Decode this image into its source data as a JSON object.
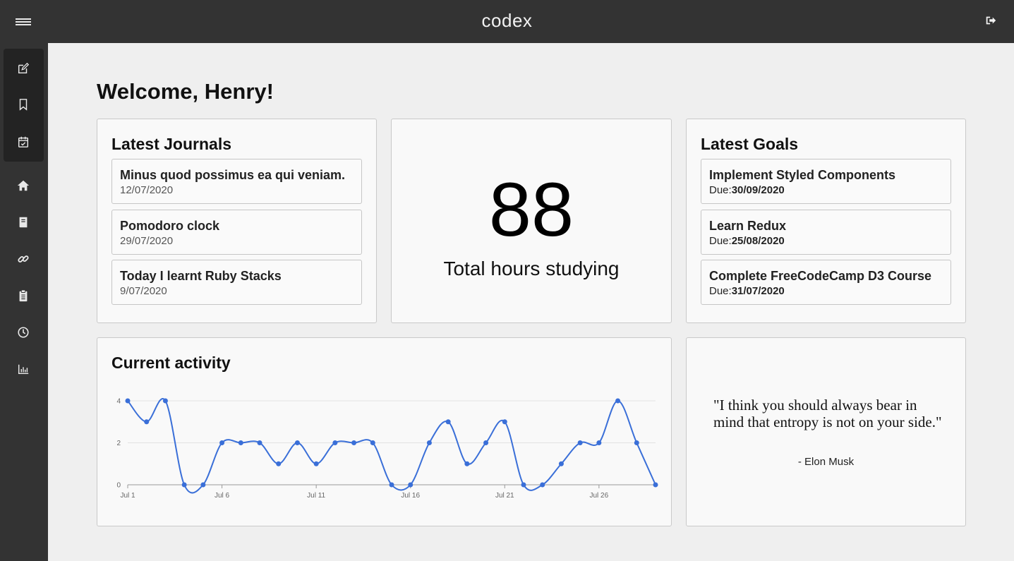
{
  "app": {
    "brand": "codex"
  },
  "page": {
    "welcome": "Welcome, Henry!"
  },
  "icons": {
    "menu": "hamburger-icon",
    "logout": "logout-icon",
    "sidebar": [
      "edit-icon",
      "bookmark-icon",
      "calendar-check-icon",
      "home-icon",
      "book-icon",
      "link-icon",
      "clipboard-icon",
      "clock-icon",
      "bar-chart-icon"
    ]
  },
  "colors": {
    "topbar": "#333333",
    "sidebar": "#333333",
    "sidebar_group": "#232323",
    "chart_line": "#3a6fd8",
    "background": "#efefef"
  },
  "journals": {
    "title": "Latest Journals",
    "items": [
      {
        "title": "Minus quod possimus ea qui veniam.",
        "date": "12/07/2020"
      },
      {
        "title": "Pomodoro clock",
        "date": "29/07/2020"
      },
      {
        "title": "Today I learnt Ruby Stacks",
        "date": "9/07/2020"
      }
    ]
  },
  "hours": {
    "value": "88",
    "caption": "Total hours studying"
  },
  "goals": {
    "title": "Latest Goals",
    "due_label": "Due:",
    "items": [
      {
        "title": "Implement Styled Components",
        "due": "30/09/2020"
      },
      {
        "title": "Learn Redux",
        "due": "25/08/2020"
      },
      {
        "title": "Complete FreeCodeCamp D3 Course",
        "due": "31/07/2020"
      }
    ]
  },
  "activity": {
    "title": "Current activity"
  },
  "quote": {
    "text": "\"I think you should always bear in mind that entropy is not on your side.\"",
    "author": "- Elon Musk"
  },
  "chart_data": {
    "type": "line",
    "x": [
      "Jul 1",
      "Jul 2",
      "Jul 3",
      "Jul 4",
      "Jul 5",
      "Jul 6",
      "Jul 7",
      "Jul 8",
      "Jul 9",
      "Jul 10",
      "Jul 11",
      "Jul 12",
      "Jul 13",
      "Jul 14",
      "Jul 15",
      "Jul 16",
      "Jul 17",
      "Jul 18",
      "Jul 19",
      "Jul 20",
      "Jul 21",
      "Jul 22",
      "Jul 23",
      "Jul 24",
      "Jul 25",
      "Jul 26",
      "Jul 27",
      "Jul 28",
      "Jul 29"
    ],
    "values": [
      4,
      3,
      4,
      0,
      0,
      2,
      2,
      2,
      1,
      2,
      1,
      2,
      2,
      2,
      0,
      0,
      2,
      3,
      1,
      2,
      3,
      0,
      0,
      1,
      2,
      2,
      4,
      2,
      0
    ],
    "x_ticks": [
      "Jul 1",
      "Jul 6",
      "Jul 11",
      "Jul 16",
      "Jul 21",
      "Jul 26"
    ],
    "y_ticks": [
      0,
      2,
      4
    ],
    "ylim": [
      0,
      4
    ],
    "grid": true,
    "title": "",
    "xlabel": "",
    "ylabel": ""
  }
}
